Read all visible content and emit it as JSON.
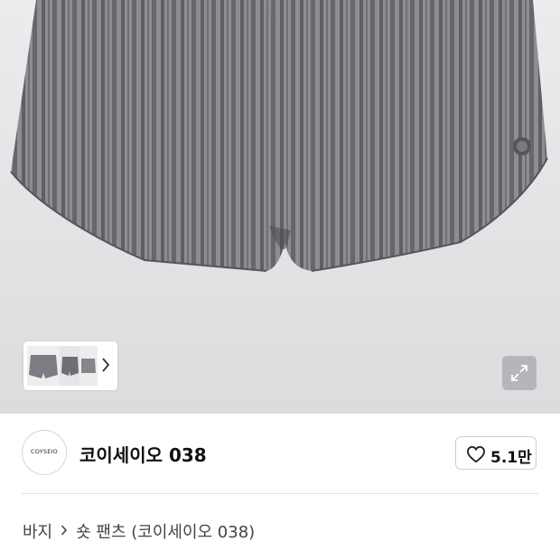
{
  "gallery": {
    "thumbnail_strip_label": "product-thumbnails",
    "expand_icon": "expand-icon"
  },
  "shop": {
    "logo_text": "COYSEIO",
    "name": "코이세이오 038",
    "like_count": "5.1만",
    "like_icon": "heart-outline-icon"
  },
  "breadcrumb": {
    "category": "바지",
    "separator_icon": "chevron-right-icon",
    "product_title": "숏 팬츠 (코이세이오 038)"
  },
  "colors": {
    "hero_bg": "#e4e4e6",
    "fabric": "#8d8d92",
    "stripe": "#5f5f65"
  }
}
